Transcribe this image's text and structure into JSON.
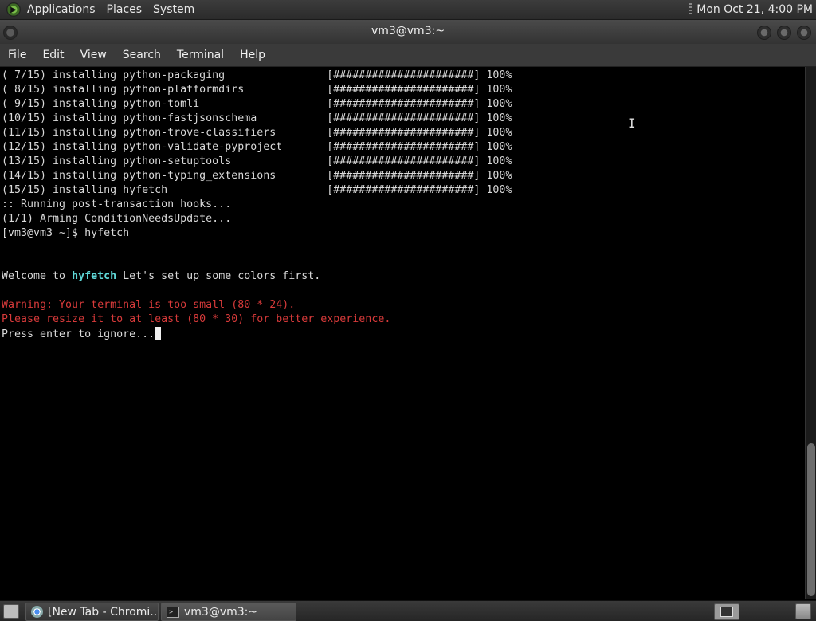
{
  "top_panel": {
    "menus": [
      "Applications",
      "Places",
      "System"
    ],
    "clock": "Mon Oct 21,  4:00 PM"
  },
  "window": {
    "title": "vm3@vm3:~"
  },
  "menubar": {
    "items": [
      "File",
      "Edit",
      "View",
      "Search",
      "Terminal",
      "Help"
    ]
  },
  "terminal": {
    "install_lines": [
      {
        "step": "( 7/15)",
        "package": "python-packaging"
      },
      {
        "step": "( 8/15)",
        "package": "python-platformdirs"
      },
      {
        "step": "( 9/15)",
        "package": "python-tomli"
      },
      {
        "step": "(10/15)",
        "package": "python-fastjsonschema"
      },
      {
        "step": "(11/15)",
        "package": "python-trove-classifiers"
      },
      {
        "step": "(12/15)",
        "package": "python-validate-pyproject"
      },
      {
        "step": "(13/15)",
        "package": "python-setuptools"
      },
      {
        "step": "(14/15)",
        "package": "python-typing_extensions"
      },
      {
        "step": "(15/15)",
        "package": "hyfetch"
      }
    ],
    "install_verb": "installing",
    "progress_bar": "[######################]",
    "progress_percent": "100%",
    "hooks_line": ":: Running post-transaction hooks...",
    "arming_line": "(1/1) Arming ConditionNeedsUpdate...",
    "prompt": "[vm3@vm3 ~]$ ",
    "command": "hyfetch",
    "welcome_prefix": "Welcome to ",
    "welcome_app": "hyfetch",
    "welcome_suffix": " Let's set up some colors first.",
    "warning_line": "Warning: Your terminal is too small (80 * 24).",
    "resize_line": "Please resize it to at least (80 * 30) for better experience.",
    "press_enter": "Press enter to ignore..."
  },
  "taskbar": {
    "tasks": [
      {
        "label": "[New Tab - Chromi...",
        "icon": "chromium-icon",
        "active": false
      },
      {
        "label": "vm3@vm3:~",
        "icon": "terminal-icon",
        "active": true
      }
    ]
  },
  "colors": {
    "terminal_bg": "#000000",
    "terminal_fg": "#d9d9d9",
    "warning_red": "#d73a3a",
    "highlight_cyan": "#5fd7d7"
  }
}
